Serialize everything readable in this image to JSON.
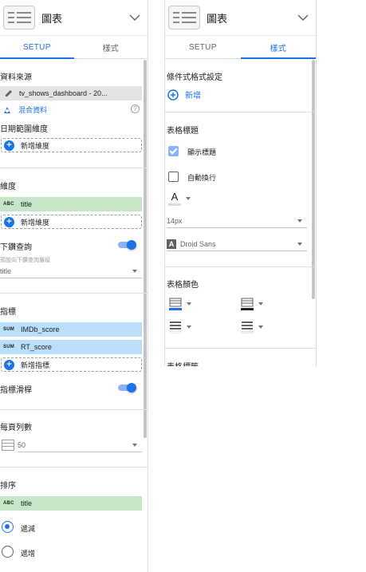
{
  "chart": {
    "title": "圖表"
  },
  "tabs": {
    "setup": "SETUP",
    "style": "樣式"
  },
  "setup": {
    "data_source": {
      "title": "資料來源",
      "name": "tv_shows_dashboard - 20...",
      "blend_label": "混合資料"
    },
    "date_range": {
      "title": "日期範圍維度",
      "add_label": "新增維度"
    },
    "dimension": {
      "title": "維度",
      "chip_type": "ABC",
      "chip_name": "title",
      "add_label": "新增維度"
    },
    "drill_down": {
      "title": "下鑽查詢",
      "hint": "預設向下鑽查詢層級",
      "value": "title"
    },
    "metric": {
      "title": "指標",
      "chips": [
        {
          "type": "SUM",
          "name": "IMDb_score"
        },
        {
          "type": "SUM",
          "name": "RT_score"
        }
      ],
      "add_label": "新增指標"
    },
    "metric_slider": {
      "title": "指標滑桿"
    },
    "rows_per_page": {
      "title": "每頁列數",
      "value": "50"
    },
    "sort": {
      "title": "排序",
      "chip_type": "ABC",
      "chip_name": "title",
      "descending": "遞減",
      "ascending": "遞增"
    }
  },
  "style": {
    "conditional_format": {
      "title": "條件式格式設定",
      "add_label": "新增"
    },
    "table_header": {
      "title": "表格標題",
      "show_header": "顯示標題",
      "wrap_text": "自動換行",
      "font_size": "14px",
      "font_family": "Droid Sans"
    },
    "table_colors": {
      "title": "表格顏色"
    },
    "next_section_title": "表格標籤"
  },
  "colors": {
    "accent": "#1a73e8",
    "dimension_chip": "#c6e6c7",
    "metric_chip": "#bbdefb"
  }
}
